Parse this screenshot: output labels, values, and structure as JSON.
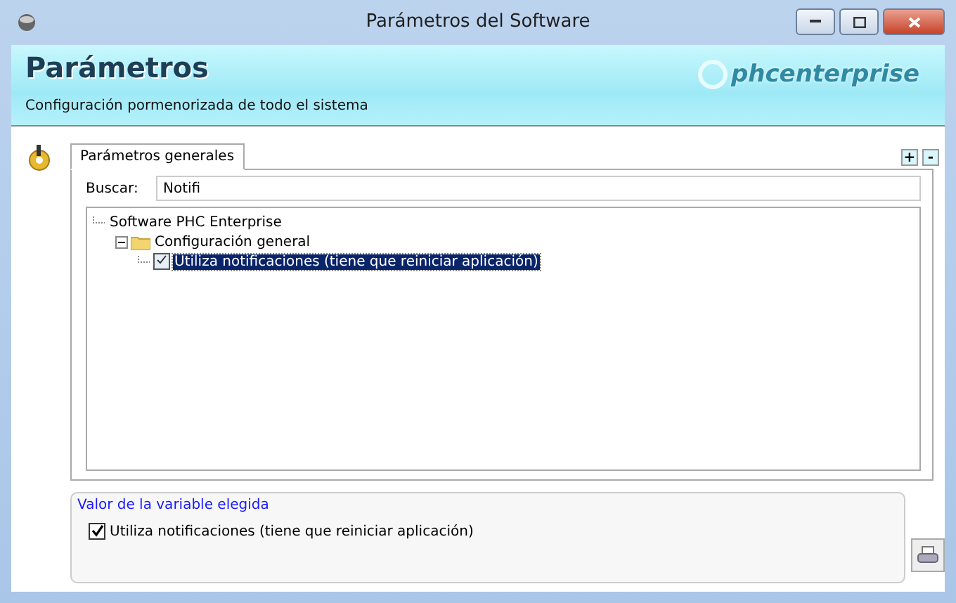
{
  "window": {
    "title": "Parámetros del Software"
  },
  "header": {
    "title": "Parámetros",
    "subtitle": "Configuración pormenorizada de todo el sistema",
    "logo": "phcenterprise"
  },
  "tabs": [
    {
      "label": "Parámetros generales",
      "selected": true
    }
  ],
  "tree_buttons": [
    "+",
    "-"
  ],
  "search": {
    "label": "Buscar:",
    "value": "Notifi"
  },
  "tree": [
    {
      "label": "Software PHC Enterprise",
      "kind": "root",
      "selected": false,
      "children": [
        {
          "label": "Configuración general",
          "kind": "folder",
          "selected": false,
          "expanded": true,
          "children": [
            {
              "label": "Utiliza notificaciones (tiene que reiniciar aplicación)",
              "kind": "check",
              "checked": true,
              "selected": true
            }
          ]
        }
      ]
    }
  ],
  "value_panel": {
    "title": "Valor de la variable elegida",
    "checkbox": {
      "label": "Utiliza notificaciones (tiene que reiniciar aplicación)",
      "checked": true
    }
  }
}
